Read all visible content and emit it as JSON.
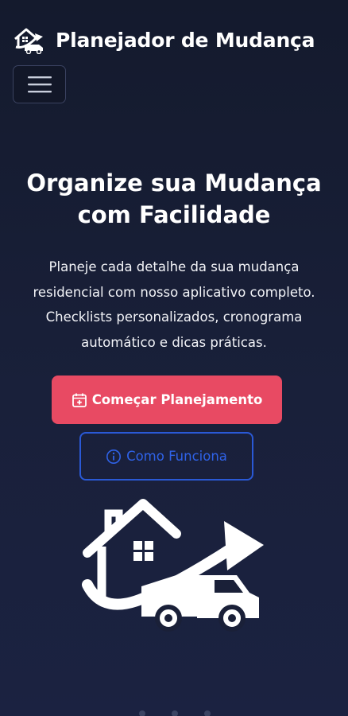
{
  "navbar": {
    "brand_text": "Planejador de Mudança",
    "brand_icon": "moving-house-truck-icon",
    "menu_icon": "hamburger-menu-icon"
  },
  "hero": {
    "title": "Organize sua Mudança com Facilidade",
    "description": "Planeje cada detalhe da sua mudança residencial com nosso aplicativo completo. Checklists personalizados, cronograma automático e dicas práticas.",
    "primary_button": {
      "label": "Começar Planejamento",
      "icon": "calendar-plus-icon"
    },
    "secondary_button": {
      "label": "Como Funciona",
      "icon": "info-circle-icon"
    },
    "illustration": "house-truck-arrow-illustration"
  },
  "colors": {
    "background": "#161c31",
    "primary": "#e84a63",
    "outline_blue": "#2a59d6",
    "text": "#ffffff"
  }
}
